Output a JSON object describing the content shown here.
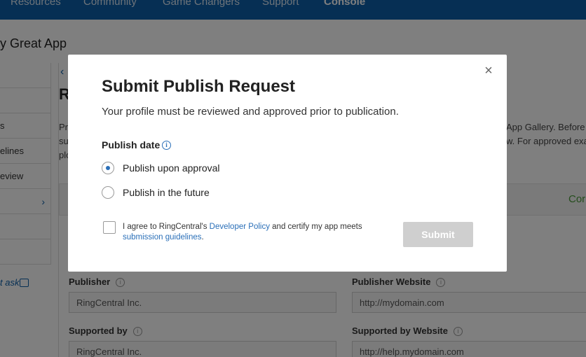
{
  "nav": {
    "items": [
      "Resources",
      "Community",
      "Game Changers",
      "Support"
    ],
    "active": "Console"
  },
  "background": {
    "app_title": "y Great App",
    "sidebar_items": [
      "",
      "",
      "s",
      "elines",
      "eview",
      "",
      "",
      ""
    ],
    "ask_label": "t ask",
    "heading": "R",
    "intro_lines": [
      "Pr",
      "su",
      "plo"
    ],
    "intro_right_lines": [
      "App Gallery. Before",
      "w. For approved exa"
    ],
    "bar_label": "Cor",
    "fields": {
      "publisher_label": "Publisher",
      "publisher_value": "RingCentral Inc.",
      "publisher_website_label": "Publisher Website",
      "publisher_website_value": "http://mydomain.com",
      "supported_by_label": "Supported by",
      "supported_by_value": "RingCentral Inc.",
      "supported_by_website_label": "Supported by Website",
      "supported_by_website_value": "http://help.mydomain.com"
    }
  },
  "modal": {
    "close_glyph": "×",
    "title": "Submit Publish Request",
    "subtitle": "Your profile must be reviewed and approved prior to publication.",
    "publish_date_label": "Publish date",
    "info_glyph": "i",
    "options": [
      {
        "label": "Publish upon approval",
        "checked": true
      },
      {
        "label": "Publish in the future",
        "checked": false
      }
    ],
    "agree_prefix": "I agree to RingCentral's ",
    "agree_link1": "Developer Policy",
    "agree_middle": " and certify my app meets ",
    "agree_link2": "submission guidelines",
    "agree_suffix": ".",
    "agree_checked": false,
    "submit_label": "Submit",
    "submit_enabled": false
  },
  "colors": {
    "nav_bg": "#0d5fa8",
    "accent": "#2a6fb8",
    "submit_disabled": "#cfcfcf"
  }
}
